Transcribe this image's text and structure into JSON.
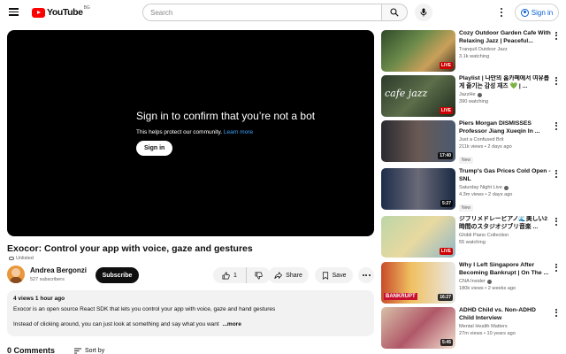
{
  "header": {
    "logo_text": "YouTube",
    "region": "BG",
    "search_placeholder": "Search",
    "signin_label": "Sign in"
  },
  "player": {
    "gate_title": "Sign in to confirm that you’re not a bot",
    "gate_sub": "This helps protect our community.",
    "gate_link": "Learn more",
    "gate_button": "Sign in"
  },
  "video": {
    "title": "Exocor: Control your app with voice, gaze and gestures",
    "visibility": "Unlisted",
    "channel_name": "Andrea Bergonzi",
    "subscribers": "527 subscribers",
    "subscribe_label": "Subscribe",
    "like_count": "1",
    "share_label": "Share",
    "save_label": "Save"
  },
  "description": {
    "meta": "4 views  1 hour ago",
    "line1": "Exocor is an open source React SDK that lets you control your app with voice, gaze and hand gestures",
    "line2": "Instead of clicking around, you can just look at something and say what you want",
    "more": "...more"
  },
  "comments": {
    "count_label": "0 Comments",
    "sort_label": "Sort by"
  },
  "recommendations": [
    {
      "title": "Cozy Outdoor Garden Cafe With Relaxing Jazz | Peaceful...",
      "channel": "Tranquil Outdoor Jazz",
      "meta": "3.1k watching",
      "badge": "LIVE",
      "thumb_text": ""
    },
    {
      "title": "Playlist | 나만의 홈카페에서 여유롭게 즐기는 감성 재즈 💚 | ...",
      "channel": "JazzHe",
      "meta": "390 watching",
      "badge": "LIVE",
      "thumb_text": "cafe jazz"
    },
    {
      "title": "Piers Morgan DISMISSES Professor Jiang Xueqin In ...",
      "channel": "Just a Confused Brit",
      "meta": "211k views • 2 days ago",
      "badge": "17:40",
      "tag": "New",
      "thumb_text": ""
    },
    {
      "title": "Trump's Gas Prices Cold Open - SNL",
      "channel": "Saturday Night Live",
      "meta": "4.3m views • 2 days ago",
      "badge": "5:27",
      "tag": "New",
      "thumb_text": ""
    },
    {
      "title": "ジブリメドレーピアノ🌊美しい2時間のスタジオジブリ音楽 ...",
      "channel": "Ghibli Piano Collection",
      "meta": "55 watching",
      "badge": "LIVE",
      "thumb_text": ""
    },
    {
      "title": "Why I Left Singapore After Becoming Bankrupt | On The ...",
      "channel": "CNA Insider",
      "meta": "180k views • 2 weeks ago",
      "badge": "16:27",
      "thumb_text": "BANKRUPT"
    },
    {
      "title": "ADHD Child vs. Non-ADHD Child Interview",
      "channel": "Mental Health Matters",
      "meta": "27m views • 10 years ago",
      "badge": "5:45",
      "thumb_text": ""
    }
  ]
}
